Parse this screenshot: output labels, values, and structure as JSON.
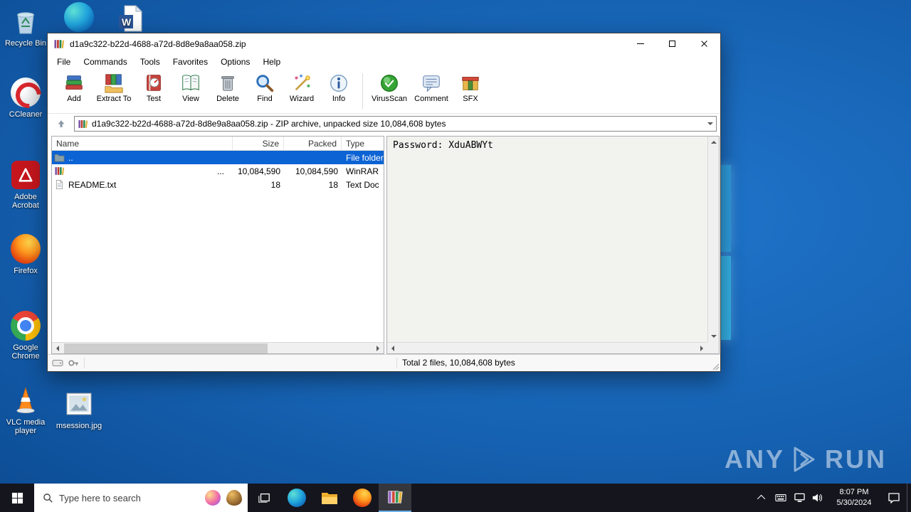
{
  "desktop": {
    "icons": {
      "recycle_bin": "Recycle Bin",
      "ccleaner": "CCleaner",
      "adobe": "Adobe Acrobat",
      "firefox": "Firefox",
      "chrome": "Google Chrome",
      "vlc": "VLC media player",
      "msession": "msession.jpg"
    }
  },
  "window": {
    "title": "d1a9c322-b22d-4688-a72d-8d8e9a8aa058.zip",
    "menu": [
      "File",
      "Commands",
      "Tools",
      "Favorites",
      "Options",
      "Help"
    ],
    "toolbar": [
      {
        "label": "Add",
        "icon": "add-books-icon"
      },
      {
        "label": "Extract To",
        "icon": "extract-to-icon"
      },
      {
        "label": "Test",
        "icon": "test-icon"
      },
      {
        "label": "View",
        "icon": "view-icon"
      },
      {
        "label": "Delete",
        "icon": "delete-icon"
      },
      {
        "label": "Find",
        "icon": "find-icon"
      },
      {
        "label": "Wizard",
        "icon": "wizard-icon"
      },
      {
        "label": "Info",
        "icon": "info-icon"
      },
      {
        "label": "VirusScan",
        "icon": "virusscan-icon"
      },
      {
        "label": "Comment",
        "icon": "comment-icon"
      },
      {
        "label": "SFX",
        "icon": "sfx-icon"
      }
    ],
    "address": "d1a9c322-b22d-4688-a72d-8d8e9a8aa058.zip - ZIP archive, unpacked size 10,084,608 bytes",
    "columns": [
      "Name",
      "Size",
      "Packed",
      "Type"
    ],
    "rows": [
      {
        "name": "..",
        "size": "",
        "packed": "",
        "type": "File folder"
      },
      {
        "name": "...",
        "size": "10,084,590",
        "packed": "10,084,590",
        "type": "WinRAR"
      },
      {
        "name": "README.txt",
        "size": "18",
        "packed": "18",
        "type": "Text Doc"
      }
    ],
    "comment": "Password: XduABWYt",
    "status": "Total 2 files, 10,084,608 bytes"
  },
  "taskbar": {
    "search_placeholder": "Type here to search",
    "clock": {
      "time": "8:07 PM",
      "date": "5/30/2024"
    }
  },
  "watermark": {
    "any": "ANY",
    "run": "RUN"
  },
  "colors": {
    "selection": "#0c63d4",
    "taskbar": "#15151e",
    "desktop_accent": "#2f9fe0"
  }
}
